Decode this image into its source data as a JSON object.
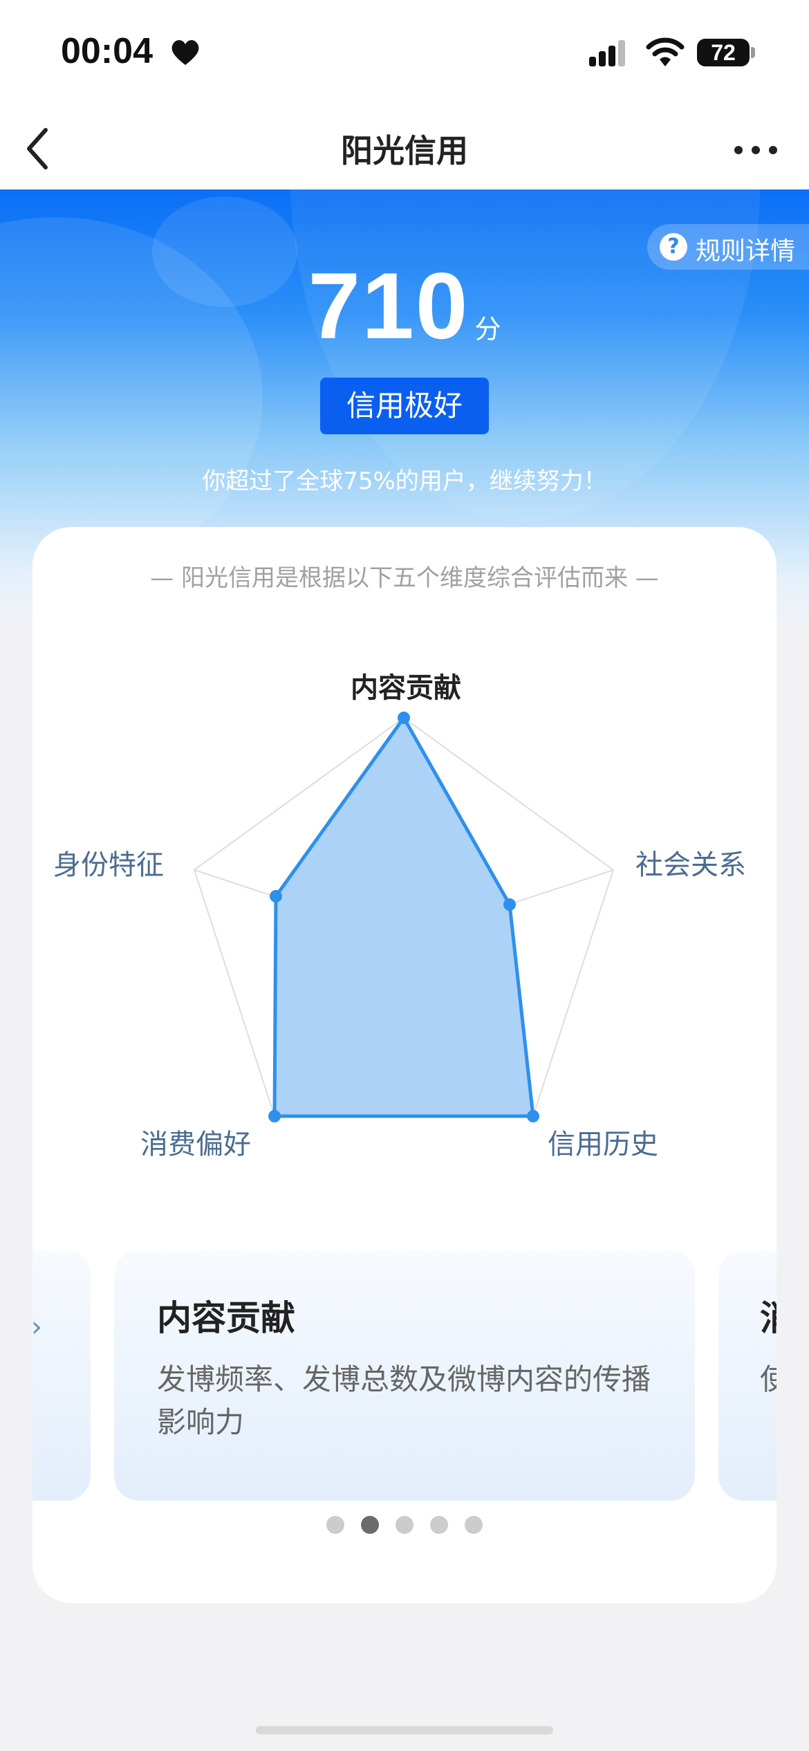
{
  "status_bar": {
    "time": "00:04",
    "battery": "72"
  },
  "nav": {
    "title": "阳光信用"
  },
  "header": {
    "rule_button_label": "规则详情",
    "help_glyph": "?",
    "score": "710",
    "score_unit": "分",
    "level": "信用极好",
    "rank_text": "你超过了全球75%的用户，继续努力！"
  },
  "card": {
    "subtitle": "— 阳光信用是根据以下五个维度综合评估而来 —",
    "radar": {
      "dimensions": [
        "内容贡献",
        "社会关系",
        "信用历史",
        "消费偏好",
        "身份特征"
      ],
      "active_dimension": "内容贡献",
      "fill_color": "#a9d0f8",
      "stroke_color": "#2e90ec"
    },
    "carousel": {
      "current": {
        "title": "内容贡献",
        "description": "发博频率、发博总数及微博内容的传播影响力"
      },
      "next_peek_title": "消",
      "next_peek_desc": "使",
      "prev_peek_glyph": "›",
      "active_index": 1,
      "total": 5
    }
  }
}
